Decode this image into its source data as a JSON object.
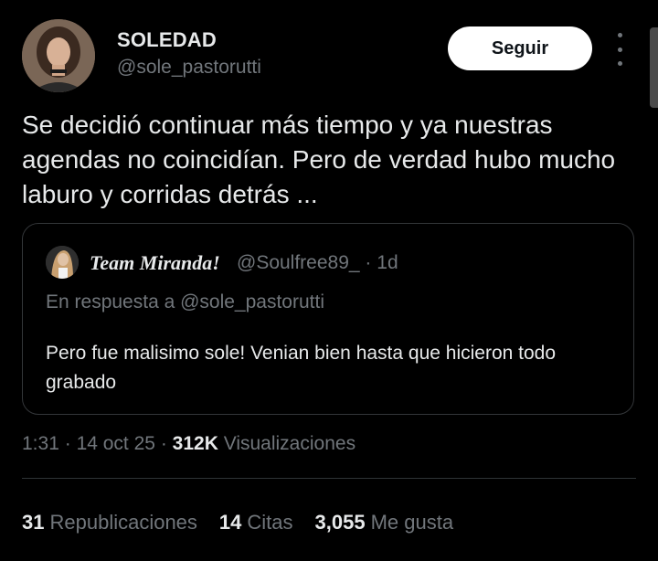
{
  "author": {
    "name": "SOLEDAD",
    "handle": "@sole_pastorutti",
    "follow_label": "Seguir"
  },
  "tweet": {
    "text": "Se decidió continuar más tiempo y ya nuestras agendas no coincidían. Pero de verdad hubo mucho laburo y corridas detrás ..."
  },
  "quote": {
    "name": "Team Miranda!",
    "handle": "@Soulfree89_",
    "separator": "·",
    "age": "1d",
    "reply_to": "En respuesta a @sole_pastorutti",
    "text": "Pero fue malisimo sole! Venian bien hasta que hicieron todo grabado"
  },
  "meta": {
    "time": "1:31",
    "date": "14 oct 25",
    "separator": "·",
    "views_count": "312K",
    "views_label": "Visualizaciones"
  },
  "stats": [
    {
      "count": "31",
      "label": "Republicaciones"
    },
    {
      "count": "14",
      "label": "Citas"
    },
    {
      "count": "3,055",
      "label": "Me gusta"
    }
  ],
  "colors": {
    "background": "#000000",
    "text_primary": "#e7e9ea",
    "text_secondary": "#71767b",
    "border": "#333639",
    "follow_bg": "#ffffff"
  }
}
